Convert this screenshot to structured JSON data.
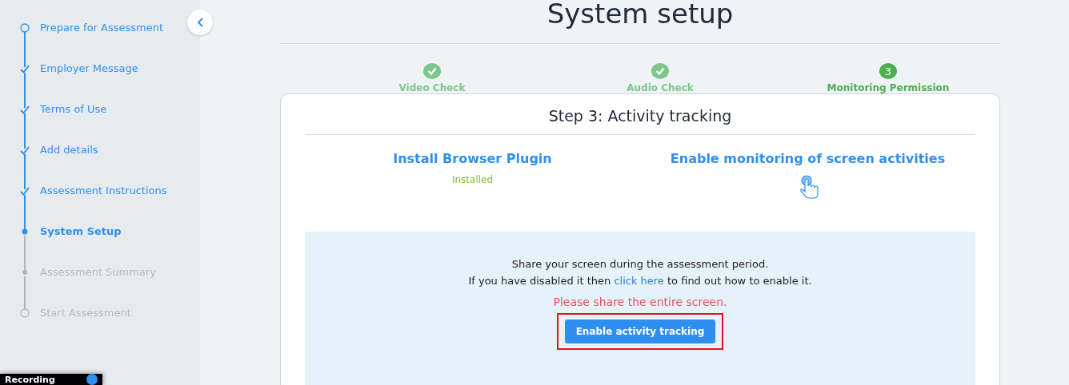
{
  "sidebar": {
    "steps": [
      {
        "label": "Prepare for Assessment",
        "kind": "start"
      },
      {
        "label": "Employer Message",
        "kind": "done"
      },
      {
        "label": "Terms of Use",
        "kind": "done"
      },
      {
        "label": "Add details",
        "kind": "done"
      },
      {
        "label": "Assessment Instructions",
        "kind": "done"
      },
      {
        "label": "System Setup",
        "kind": "current"
      },
      {
        "label": "Assessment Summary",
        "kind": "pending"
      },
      {
        "label": "Start Assessment",
        "kind": "end"
      }
    ],
    "recording": {
      "label": "Recording"
    }
  },
  "page": {
    "title": "System setup",
    "checks": [
      {
        "label": "Video Check",
        "kind": "done"
      },
      {
        "label": "Audio Check",
        "kind": "done"
      },
      {
        "label": "Monitoring Permission",
        "kind": "current",
        "number": "3"
      }
    ],
    "card": {
      "title": "Step 3: Activity tracking",
      "columns": [
        {
          "heading": "Install Browser Plugin",
          "kind": "status",
          "status": "Installed"
        },
        {
          "heading": "Enable monitoring of screen activities",
          "kind": "pointer"
        }
      ],
      "panel": {
        "line_1": "Share your screen during the assessment period.",
        "line_2_before": "If you have disabled it then",
        "link": "click here",
        "line_2_after": "to find out how to enable it.",
        "warning": "Please share the entire screen.",
        "button": "Enable activity tracking",
        "highlighted": true
      }
    }
  }
}
